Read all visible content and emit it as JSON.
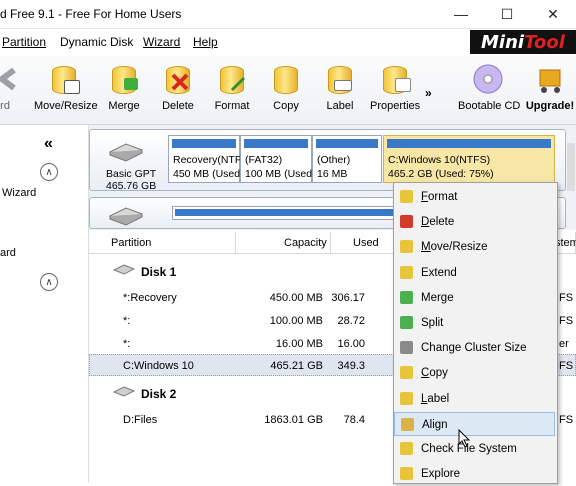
{
  "window": {
    "title": "d Free 9.1 - Free For Home Users",
    "controls": [
      "—",
      "☐",
      "✕"
    ]
  },
  "menu": [
    {
      "label": "Partition",
      "underline": "P"
    },
    {
      "label": "Dynamic Disk",
      "underline": ""
    },
    {
      "label": "Wizard",
      "underline": "W"
    },
    {
      "label": "Help",
      "underline": "H"
    }
  ],
  "brand": {
    "part1": "Mini",
    "part2": "Tool"
  },
  "toolbar": [
    {
      "label": "ard",
      "icon": "arrow-left-icon"
    },
    {
      "label": "Move/Resize",
      "icon": "move-resize-icon"
    },
    {
      "label": "Merge",
      "icon": "merge-icon"
    },
    {
      "label": "Delete",
      "icon": "delete-icon"
    },
    {
      "label": "Format",
      "icon": "format-icon"
    },
    {
      "label": "Copy",
      "icon": "copy-icon"
    },
    {
      "label": "Label",
      "icon": "label-icon"
    },
    {
      "label": "Properties",
      "icon": "properties-icon"
    },
    {
      "label": "»",
      "icon": "more-icon"
    },
    {
      "label": "Bootable CD",
      "icon": "cd-icon"
    },
    {
      "label": "Upgrade!",
      "icon": "cart-icon"
    }
  ],
  "left_panel": {
    "collapse": "«",
    "section1": "Wizard",
    "section2": "ard"
  },
  "disk_map": {
    "disk1": {
      "type": "Basic GPT",
      "size": "465.76 GB"
    },
    "partitions": [
      {
        "line1": "Recovery(NTF",
        "line2": "450 MB (Used:"
      },
      {
        "line1": "(FAT32)",
        "line2": "100 MB (Used:"
      },
      {
        "line1": "(Other)",
        "line2": "16 MB"
      },
      {
        "line1": "C:Windows 10(NTFS)",
        "line2": "465.2 GB (Used: 75%)"
      }
    ]
  },
  "table": {
    "headers": [
      "Partition",
      "Capacity",
      "Used",
      "File System"
    ],
    "header_fs_visible": "stem",
    "groups": [
      {
        "disk": "Disk 1",
        "rows": [
          {
            "partition": "*:Recovery",
            "capacity": "450.00 MB",
            "used": "306.17",
            "fs": "FS"
          },
          {
            "partition": "*:",
            "capacity": "100.00 MB",
            "used": "28.72",
            "fs": "FS"
          },
          {
            "partition": "*:",
            "capacity": "16.00 MB",
            "used": "16.00",
            "fs": "er"
          },
          {
            "partition": "C:Windows 10",
            "capacity": "465.21 GB",
            "used": "349.3",
            "fs": "FS"
          }
        ]
      },
      {
        "disk": "Disk 2",
        "rows": [
          {
            "partition": "D:Files",
            "capacity": "1863.01 GB",
            "used": "78.4",
            "fs": "FS"
          }
        ]
      }
    ]
  },
  "context_menu": [
    {
      "label": "Format",
      "underline": "F",
      "icon": "format-icon",
      "color": "#e8c43a"
    },
    {
      "label": "Delete",
      "underline": "D",
      "icon": "delete-icon",
      "color": "#d43a2a"
    },
    {
      "label": "Move/Resize",
      "underline": "M",
      "icon": "move-resize-icon",
      "color": "#e8c43a"
    },
    {
      "label": "Extend",
      "underline": "",
      "icon": "extend-icon",
      "color": "#e8c43a"
    },
    {
      "label": "Merge",
      "underline": "",
      "icon": "merge-icon",
      "color": "#4caf50"
    },
    {
      "label": "Split",
      "underline": "",
      "icon": "split-icon",
      "color": "#4caf50"
    },
    {
      "label": "Change Cluster Size",
      "underline": "",
      "icon": "cluster-icon",
      "color": "#8a8a8a"
    },
    {
      "label": "Copy",
      "underline": "C",
      "icon": "copy-icon",
      "color": "#e8c43a"
    },
    {
      "label": "Label",
      "underline": "L",
      "icon": "label-icon",
      "color": "#e8c43a"
    },
    {
      "label": "Align",
      "underline": "",
      "icon": "align-icon",
      "color": "#d9b24a"
    },
    {
      "label": "Check File System",
      "underline": "",
      "icon": "check-icon",
      "color": "#e8c43a"
    },
    {
      "label": "Explore",
      "underline": "",
      "icon": "explore-icon",
      "color": "#e8c43a"
    }
  ],
  "colors": {
    "accent": "#3a78c8",
    "selected_partition": "#f7e7a6",
    "menu_highlight": "#dde8f5"
  }
}
